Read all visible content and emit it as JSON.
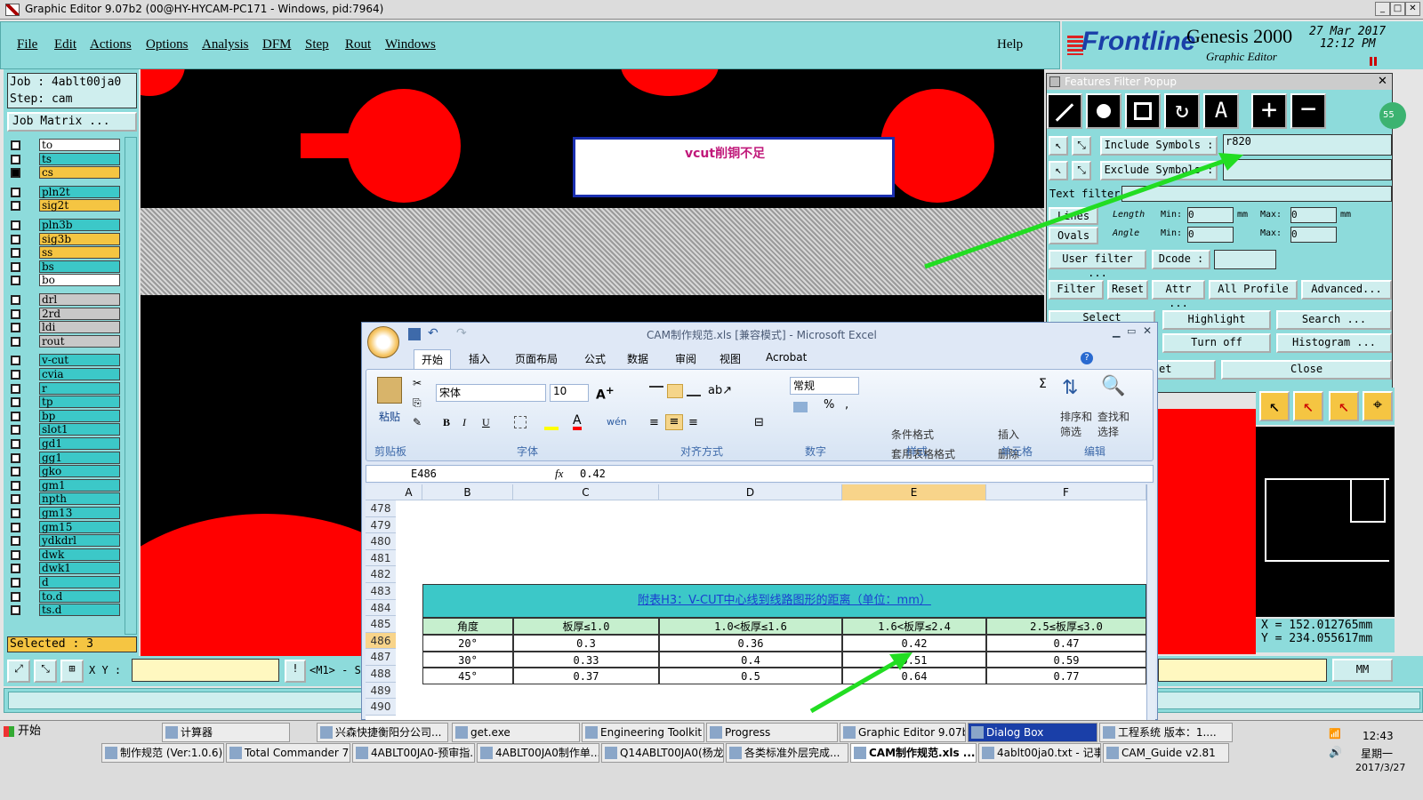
{
  "window": {
    "title": "Graphic Editor 9.07b2 (00@HY-HYCAM-PC171 - Windows, pid:7964)"
  },
  "menu": {
    "items": [
      "File",
      "Edit",
      "Actions",
      "Options",
      "Analysis",
      "DFM",
      "Step",
      "Rout",
      "Windows"
    ],
    "help": "Help"
  },
  "brand": {
    "logo": "Frontline",
    "product": "Genesis 2000",
    "subtitle": "Graphic Editor",
    "date": "27 Mar 2017",
    "time": "12:12 PM"
  },
  "job": {
    "job_line": "Job : 4ablt00ja0",
    "step_line": "Step: cam",
    "matrix_button": "Job Matrix ...",
    "selected": "Selected : 3"
  },
  "layers": [
    "to",
    "ts",
    "cs",
    "pln2t",
    "sig2t",
    "pln3b",
    "sig3b",
    "ss",
    "bs",
    "bo",
    "drl",
    "2rd",
    "ldi",
    "rout",
    "v-cut",
    "cvia",
    "r",
    "tp",
    "bp",
    "slot1",
    "gd1",
    "gg1",
    "gko",
    "gm1",
    "npth",
    "gm13",
    "gm15",
    "ydkdrl",
    "dwk",
    "dwk1",
    "d",
    "to.d",
    "ts.d"
  ],
  "canvas": {
    "annotation": "vcut削铜不足"
  },
  "filter": {
    "title": "Features Filter Popup",
    "include_label": "Include Symbols :",
    "include_value": "r820",
    "exclude_label": "Exclude Symbols :",
    "text_filter": "Text filter",
    "lines_label": "Lines",
    "ovals_label": "Ovals",
    "length_label": "Length",
    "angle_label": "Angle",
    "min_label": "Min:",
    "max_label": "Max:",
    "min_value": "0",
    "max_value": "0",
    "unit": "mm",
    "user_filter": "User filter ...",
    "dcode": "Dcode :",
    "filter_btn": "Filter",
    "reset_btn": "Reset",
    "attr_btn": "Attr ...",
    "all_profile": "All Profile",
    "advanced": "Advanced...",
    "select_btn": "Select",
    "highlight_btn": "Highlight",
    "search_btn": "Search ...",
    "turnoff_btn": "Turn off",
    "histogram_btn": "Histogram ...",
    "reset_short": "et",
    "close_btn": "Close",
    "badge": "55"
  },
  "coords": {
    "x": "X  =  152.012765mm",
    "y": "Y  =  234.055617mm",
    "units": "MM",
    "xy_label": "X Y :",
    "status": "<M1> - S"
  },
  "excel": {
    "title": "CAM制作规范.xls  [兼容模式] - Microsoft Excel",
    "tabs": [
      "开始",
      "插入",
      "页面布局",
      "公式",
      "数据",
      "审阅",
      "视图",
      "Acrobat"
    ],
    "font_name": "宋体",
    "font_size": "10",
    "number_format": "常规",
    "paste": "粘贴",
    "groups": [
      "剪贴板",
      "字体",
      "对齐方式",
      "数字",
      "样式",
      "单元格",
      "编辑"
    ],
    "styles": [
      "条件格式",
      "套用表格格式",
      "单元格样式"
    ],
    "cells_ops": [
      "插入",
      "删除",
      "格式"
    ],
    "edit_ops": [
      "排序和\n筛选",
      "查找和\n选择"
    ],
    "name_box": "E486",
    "formula": "0.42",
    "columns": [
      "A",
      "B",
      "C",
      "D",
      "E",
      "F"
    ],
    "rows": [
      "478",
      "479",
      "480",
      "481",
      "482",
      "483",
      "484",
      "485",
      "486",
      "487",
      "488",
      "489",
      "490"
    ],
    "table_title": "附表H3：V-CUT中心线到线路图形的距离（单位：mm）",
    "headers": [
      "角度",
      "板厚≤1.0",
      "1.0<板厚≤1.6",
      "1.6<板厚≤2.4",
      "2.5≤板厚≤3.0"
    ],
    "data": [
      [
        "20°",
        "0.3",
        "0.36",
        "0.42",
        "0.47"
      ],
      [
        "30°",
        "0.33",
        "0.4",
        "0.51",
        "0.59"
      ],
      [
        "45°",
        "0.37",
        "0.5",
        "0.64",
        "0.77"
      ]
    ]
  },
  "taskbar": {
    "start": "开始",
    "row1": [
      "计算器",
      "兴森快捷衡阳分公司...",
      "get.exe",
      "Engineering Toolkit 9....",
      "Progress",
      "Graphic Editor 9.07b2 ...",
      "Dialog Box",
      "工程系统  版本：1...."
    ],
    "row2": [
      "制作规范 (Ver:1.0.6)",
      "Total Commander 7.0...",
      "4ABLT00JA0-预审指...",
      "4ABLT00JA0制作单....",
      "Q14ABLT00JA0(杨龙...",
      "各类标准外层完成...",
      "CAM制作规范.xls ...",
      "4ablt00ja0.txt - 记事本",
      "CAM_Guide v2.81"
    ],
    "clock": "12:43",
    "weekday": "星期一",
    "date": "2017/3/27"
  }
}
